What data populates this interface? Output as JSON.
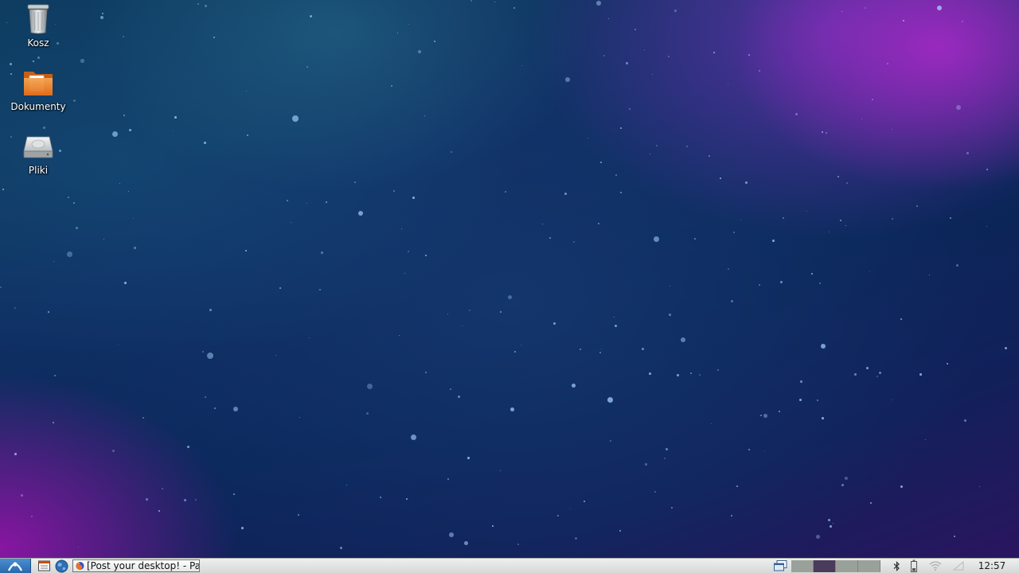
{
  "desktop": {
    "icons": [
      {
        "label": "Kosz",
        "icon": "trash-icon"
      },
      {
        "label": "Dokumenty",
        "icon": "folder-documents-icon"
      },
      {
        "label": "Pliki",
        "icon": "drive-icon"
      }
    ]
  },
  "taskbar": {
    "start_icon": "start-menu-icon",
    "launchers": [
      "file-manager-icon",
      "web-browser-icon"
    ],
    "tasks": [
      {
        "label": "[Post your desktop! - Pa...",
        "icon": "firefox-icon"
      }
    ],
    "tray_icons": [
      "show-desktop-icon",
      "bluetooth-icon",
      "battery-icon",
      "wifi-icon",
      "volume-icon"
    ],
    "workspaces": [
      {
        "active": false
      },
      {
        "active": true
      },
      {
        "active": false
      },
      {
        "active": false
      }
    ],
    "clock": "12:57"
  },
  "colors": {
    "taskbar_bg": "#e3e6e4",
    "start_button": "#2a68ae",
    "active_workspace": "#4a3a5c",
    "inactive_workspace": "#9aa09a"
  }
}
